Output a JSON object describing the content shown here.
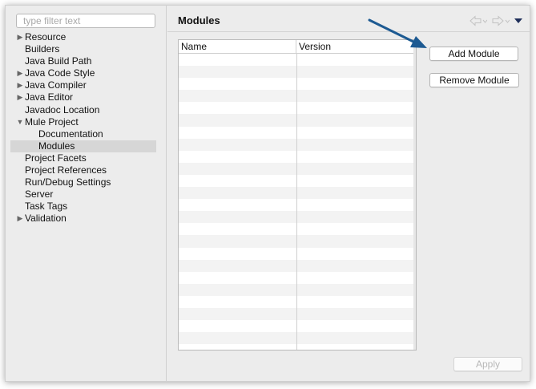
{
  "filter": {
    "placeholder": "type filter text"
  },
  "tree": [
    {
      "label": "Resource",
      "level": 0,
      "twisty": "closed"
    },
    {
      "label": "Builders",
      "level": 0,
      "twisty": "none"
    },
    {
      "label": "Java Build Path",
      "level": 0,
      "twisty": "none"
    },
    {
      "label": "Java Code Style",
      "level": 0,
      "twisty": "closed"
    },
    {
      "label": "Java Compiler",
      "level": 0,
      "twisty": "closed"
    },
    {
      "label": "Java Editor",
      "level": 0,
      "twisty": "closed"
    },
    {
      "label": "Javadoc Location",
      "level": 0,
      "twisty": "none"
    },
    {
      "label": "Mule Project",
      "level": 0,
      "twisty": "open"
    },
    {
      "label": "Documentation",
      "level": 1,
      "twisty": "none"
    },
    {
      "label": "Modules",
      "level": 1,
      "twisty": "none",
      "selected": true
    },
    {
      "label": "Project Facets",
      "level": 0,
      "twisty": "none"
    },
    {
      "label": "Project References",
      "level": 0,
      "twisty": "none"
    },
    {
      "label": "Run/Debug Settings",
      "level": 0,
      "twisty": "none"
    },
    {
      "label": "Server",
      "level": 0,
      "twisty": "none"
    },
    {
      "label": "Task Tags",
      "level": 0,
      "twisty": "none"
    },
    {
      "label": "Validation",
      "level": 0,
      "twisty": "closed"
    }
  ],
  "page": {
    "title": "Modules"
  },
  "nav": {
    "back_icon": "back-arrow-icon",
    "forward_icon": "forward-arrow-icon",
    "menu_icon": "view-menu-icon"
  },
  "table": {
    "columns": [
      "Name",
      "Version"
    ],
    "rows": []
  },
  "buttons": {
    "add_module": "Add Module",
    "remove_module": "Remove Module",
    "apply": "Apply"
  },
  "colors": {
    "annotation_arrow": "#1d5a92",
    "selection": "#d6d6d6",
    "dropdown_icon": "#1f2f5a"
  }
}
